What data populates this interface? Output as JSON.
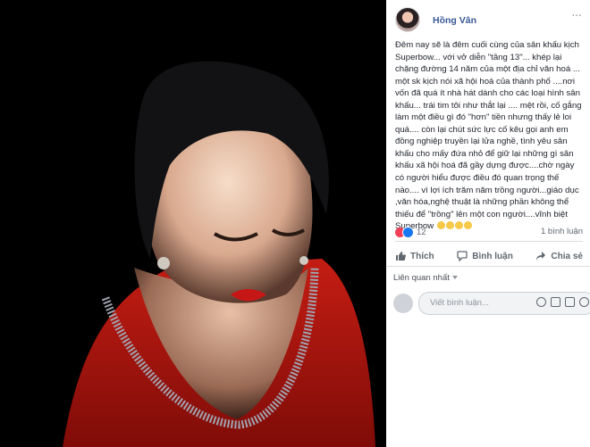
{
  "post": {
    "author": "Hồng Vân",
    "more_label": "···",
    "text": "Đêm nay sẽ là đêm cuối cùng của sân khấu kịch Superbow... với vở diễn \"tầng 13\"... khép lại chặng đường 14 năm của một địa chỉ văn hoá ... một sk kịch nói xã hội hoá của thành phố ....nơi vốn đã quá ít nhà hát dành cho các loại hình sân khấu... trái tim tôi như thắt lại .... mệt rồi, cố gắng làm một điều gì đó \"hơn\" tiền nhưng thấy lẻ loi quá.... còn lại chút sức lực cố kêu gọi anh em đồng nghiệp truyền lại lửa nghề, tình yêu sân khấu cho mấy đứa nhỏ để giữ lại những gì sân khấu xã hội hoá đã gầy dựng được....chờ ngày có người hiểu được điều đó quan trọng thế nào.... vì lợi ích trăm năm trồng người...giáo dục ,văn hóa,nghệ thuật là những phần không thể thiếu để \"trồng\" lên một con người....vĩnh biệt Superbow",
    "reactions_count": "12",
    "comments_count": "1 bình luận",
    "actions": {
      "like": "Thích",
      "comment": "Bình luận",
      "share": "Chia sẻ"
    },
    "sort_label": "Liên quan nhất",
    "comment_placeholder": "Viết bình luận...",
    "colors": {
      "link": "#385898",
      "like_blue": "#1877f2",
      "heart_red": "#f33e58"
    }
  }
}
